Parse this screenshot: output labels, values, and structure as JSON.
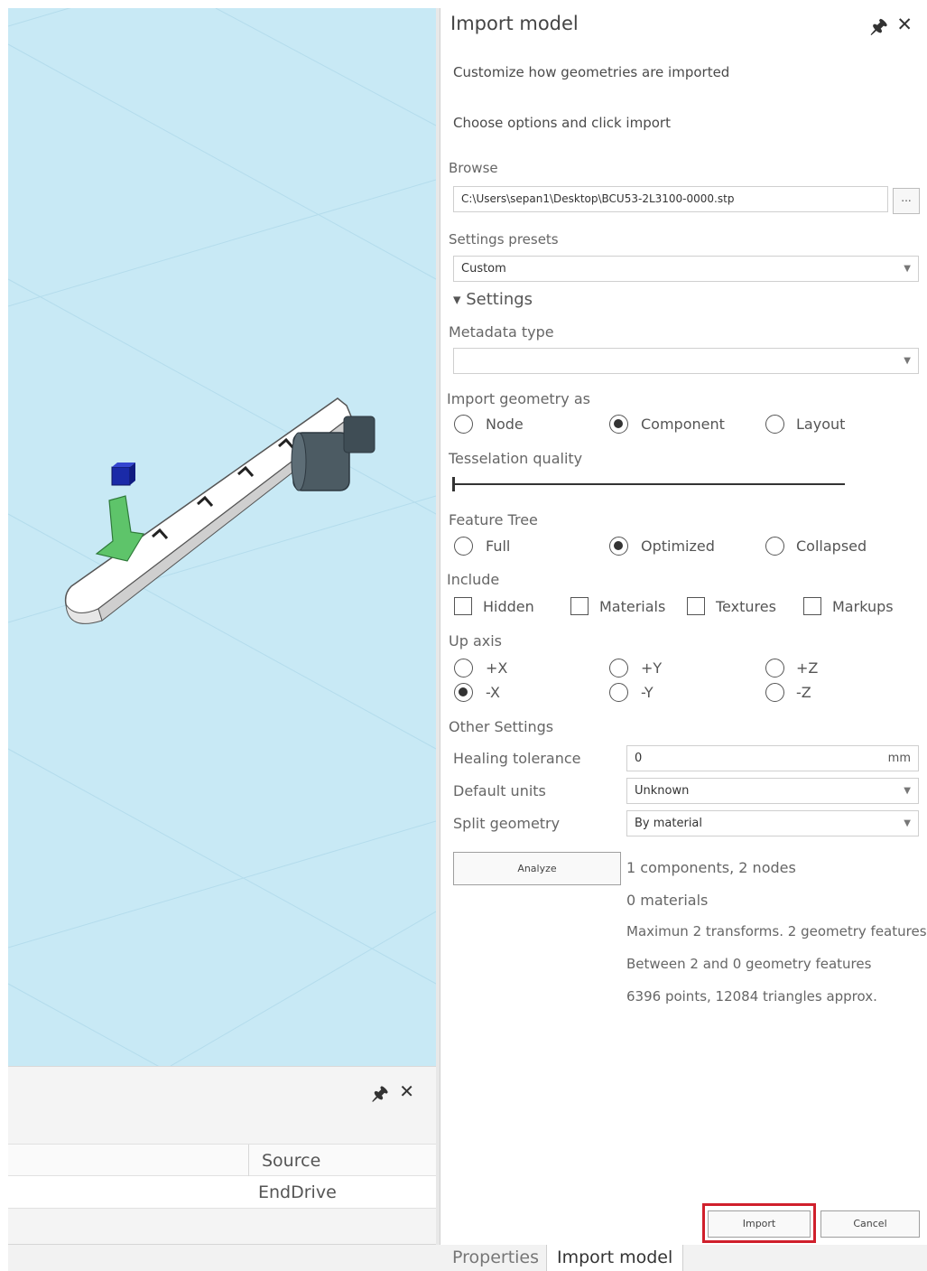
{
  "panel": {
    "title": "Import model",
    "description": "Customize how geometries are imported",
    "instruction": "Choose options and click import",
    "browse_label": "Browse",
    "browse_path": "C:\\Users\\sepan1\\Desktop\\BCU53-2L3100-0000.stp",
    "browse_button": "...",
    "presets_label": "Settings presets",
    "presets_value": "Custom",
    "settings_header": "Settings",
    "metadata_label": "Metadata type",
    "metadata_value": "",
    "import_as_label": "Import geometry as",
    "import_as_options": [
      "Node",
      "Component",
      "Layout"
    ],
    "import_as_selected": "Component",
    "tesselation_label": "Tesselation quality",
    "tesselation_level": 0,
    "feature_tree_label": "Feature Tree",
    "feature_tree_options": [
      "Full",
      "Optimized",
      "Collapsed"
    ],
    "feature_tree_selected": "Optimized",
    "include_label": "Include",
    "include_options": [
      "Hidden",
      "Materials",
      "Textures",
      "Markups"
    ],
    "up_axis_label": "Up axis",
    "up_axis_options": [
      "+X",
      "+Y",
      "+Z",
      "-X",
      "-Y",
      "-Z"
    ],
    "up_axis_selected": "-X",
    "other_label": "Other Settings",
    "healing_label": "Healing tolerance",
    "healing_value": "0",
    "healing_unit": "mm",
    "units_label": "Default units",
    "units_value": "Unknown",
    "split_label": "Split geometry",
    "split_value": "By material",
    "analyze_button": "Analyze",
    "stats": [
      "1 components, 2 nodes",
      "0 materials",
      "Maximun 2 transforms. 2 geometry features",
      "Between 2 and 0 geometry features",
      "6396 points, 12084 triangles approx."
    ],
    "import_button": "Import",
    "cancel_button": "Cancel"
  },
  "bottom_panel": {
    "column_header": "Source",
    "row_value": "EndDrive"
  },
  "tabs": [
    "Properties",
    "Import model"
  ],
  "active_tab": "Import model",
  "colors": {
    "viewport": "#c8e9f5",
    "highlight": "#d0202c"
  }
}
